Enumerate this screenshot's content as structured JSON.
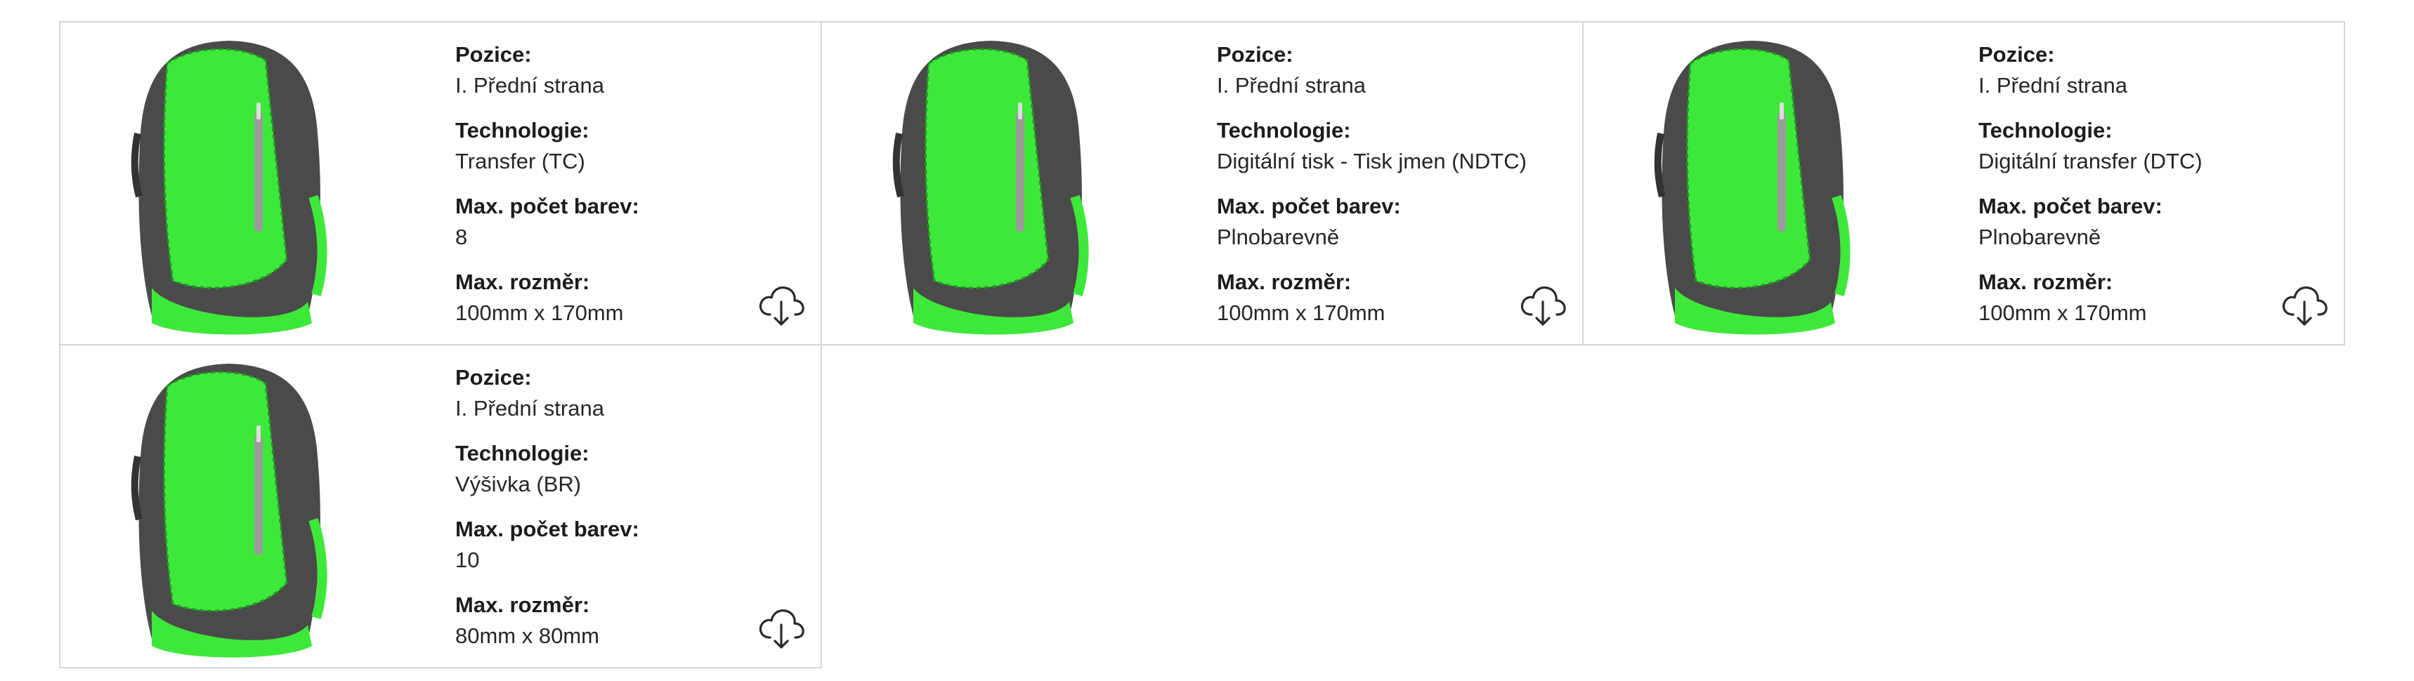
{
  "products": [
    {
      "image_icon": "backpack-image",
      "position_label": "Pozice:",
      "position_value": "I. Přední strana",
      "technology_label": "Technologie:",
      "technology_value": "Transfer (TC)",
      "colors_label": "Max. počet barev:",
      "colors_value": "8",
      "size_label": "Max. rozměr:",
      "size_value": "100mm x 170mm",
      "download_icon": "cloud-download-icon"
    },
    {
      "image_icon": "backpack-image",
      "position_label": "Pozice:",
      "position_value": "I. Přední strana",
      "technology_label": "Technologie:",
      "technology_value": "Digitální tisk - Tisk jmen (NDTC)",
      "colors_label": "Max. počet barev:",
      "colors_value": "Plnobarevně",
      "size_label": "Max. rozměr:",
      "size_value": "100mm x 170mm",
      "download_icon": "cloud-download-icon"
    },
    {
      "image_icon": "backpack-image",
      "position_label": "Pozice:",
      "position_value": "I. Přední strana",
      "technology_label": "Technologie:",
      "technology_value": "Digitální transfer (DTC)",
      "colors_label": "Max. počet barev:",
      "colors_value": "Plnobarevně",
      "size_label": "Max. rozměr:",
      "size_value": "100mm x 170mm",
      "download_icon": "cloud-download-icon"
    },
    {
      "image_icon": "backpack-image",
      "position_label": "Pozice:",
      "position_value": "I. Přední strana",
      "technology_label": "Technologie:",
      "technology_value": "Výšivka (BR)",
      "colors_label": "Max. počet barev:",
      "colors_value": "10",
      "size_label": "Max. rozměr:",
      "size_value": "80mm x 80mm",
      "download_icon": "cloud-download-icon"
    }
  ],
  "colors": {
    "backpack_green": "#3ee83a",
    "backpack_grey": "#4a4a4a",
    "border": "#d6d6d6"
  }
}
